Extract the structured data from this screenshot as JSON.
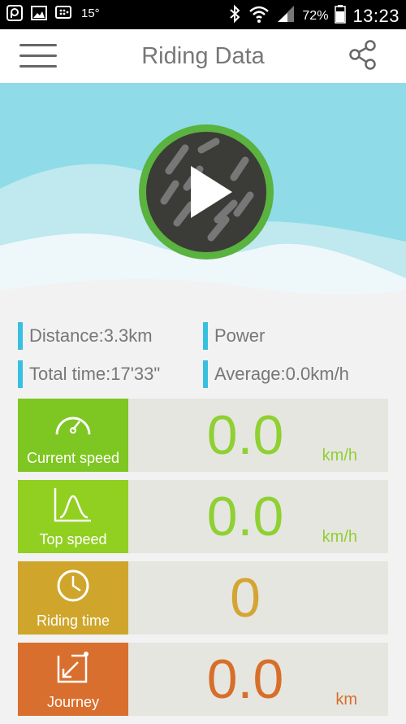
{
  "status_bar": {
    "temperature": "15°",
    "battery": "72%",
    "time": "13:23",
    "icons": [
      "p-app-icon",
      "gallery-icon",
      "bbm-icon",
      "bluetooth-icon",
      "wifi-icon",
      "signal-icon",
      "battery-icon"
    ]
  },
  "app_bar": {
    "title": "Riding Data",
    "icons": [
      "menu-icon",
      "share-icon"
    ]
  },
  "hero": {
    "icon": "play-button-wheel"
  },
  "stats": {
    "distance": "Distance:3.3km",
    "power": "Power",
    "total_time": "Total time:17'33\"",
    "average": "Average:0.0km/h"
  },
  "cards": [
    {
      "label": "Current speed",
      "value": "0.0",
      "unit": "km/h",
      "color": "#7ec621",
      "value_color": "#8fd033",
      "icon": "speedometer-icon"
    },
    {
      "label": "Top speed",
      "value": "0.0",
      "unit": "km/h",
      "color": "#91cf21",
      "value_color": "#8fd033",
      "icon": "graph-peak-icon"
    },
    {
      "label": "Riding time",
      "value": "0",
      "unit": "",
      "color": "#cfa62b",
      "value_color": "#d4a533",
      "icon": "clock-icon"
    },
    {
      "label": "Journey",
      "value": "0.0",
      "unit": "km",
      "color": "#d96f2e",
      "value_color": "#d76f2b",
      "icon": "route-arrow-icon"
    }
  ],
  "colors": {
    "accent_bar": "#37c0df",
    "hero_bg": "#8fdbe8",
    "play_ring": "#5ab23f"
  }
}
